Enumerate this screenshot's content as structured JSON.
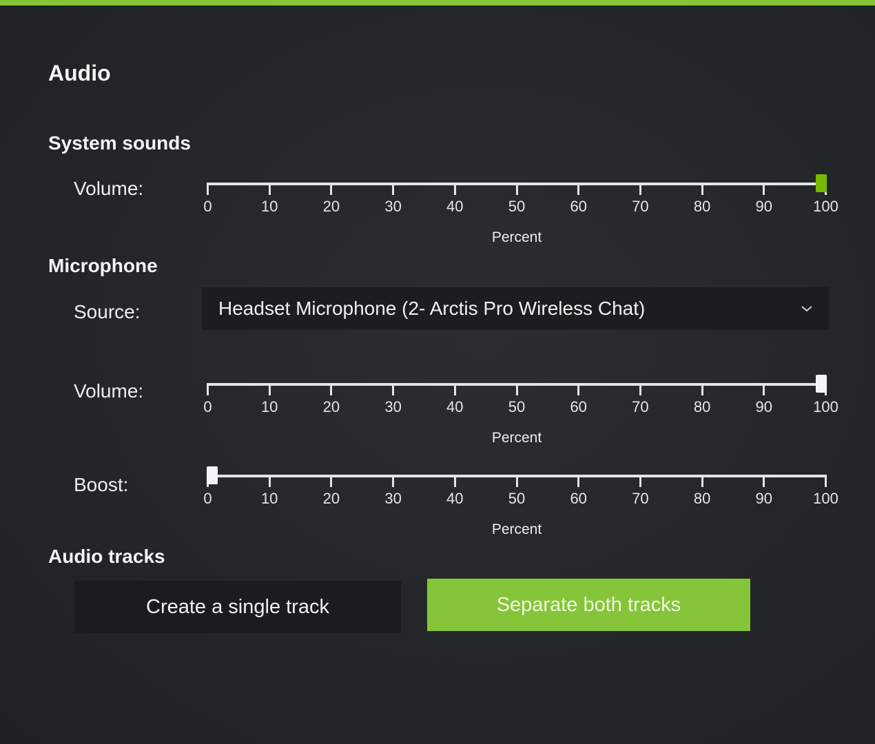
{
  "colors": {
    "accent": "#76b900",
    "accent_light": "#86c53a",
    "thumb_light": "#f4f4f4"
  },
  "headings": {
    "audio": "Audio",
    "system_sounds": "System sounds",
    "microphone": "Microphone",
    "audio_tracks": "Audio tracks"
  },
  "system_sounds": {
    "volume_label": "Volume:",
    "volume_value": 100,
    "axis_label": "Percent"
  },
  "microphone": {
    "source_label": "Source:",
    "source_value": "Headset Microphone (2- Arctis Pro Wireless Chat)",
    "source_icon": "chevron-down-icon",
    "volume_label": "Volume:",
    "volume_value": 100,
    "volume_axis_label": "Percent",
    "boost_label": "Boost:",
    "boost_value": 0,
    "boost_axis_label": "Percent"
  },
  "slider_ticks": [
    "0",
    "10",
    "20",
    "30",
    "40",
    "50",
    "60",
    "70",
    "80",
    "90",
    "100"
  ],
  "audio_tracks": {
    "single_label": "Create a single track",
    "separate_label": "Separate both tracks",
    "selected": "separate"
  }
}
